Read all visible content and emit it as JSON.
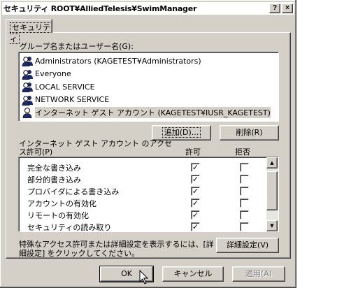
{
  "window": {
    "title": "セキュリティ ROOT¥AlliedTelesis¥SwimManager",
    "help_label": "?",
    "close_label": "×"
  },
  "tab": {
    "label": "セキュリティ"
  },
  "users": {
    "label": "グループ名またはユーザー名(G):",
    "items": [
      {
        "name": "Administrators (KAGETEST¥Administrators)",
        "icon": "group-icon"
      },
      {
        "name": "Everyone",
        "icon": "group-icon"
      },
      {
        "name": "LOCAL SERVICE",
        "icon": "group-icon"
      },
      {
        "name": "NETWORK SERVICE",
        "icon": "group-icon"
      },
      {
        "name": "インターネット ゲスト アカウント (KAGETEST¥IUSR_KAGETEST)",
        "icon": "user-icon",
        "selected": true
      }
    ],
    "add_label": "追加(D)...",
    "remove_label": "削除(R)"
  },
  "permissions": {
    "label_line1": "インターネット ゲスト アカウント のアクセ",
    "label_line2": "ス許可(P)",
    "allow_header": "許可",
    "deny_header": "拒否",
    "rows": [
      {
        "name": "完全な書き込み",
        "allow": true,
        "deny": false
      },
      {
        "name": "部分的書き込み",
        "allow": true,
        "deny": false
      },
      {
        "name": "プロバイダによる書き込み",
        "allow": true,
        "deny": false
      },
      {
        "name": "アカウントの有効化",
        "allow": true,
        "deny": false
      },
      {
        "name": "リモートの有効化",
        "allow": true,
        "deny": false
      },
      {
        "name": "セキュリティの読み取り",
        "allow": true,
        "deny": false
      }
    ]
  },
  "advanced": {
    "note_line1": "特殊なアクセス許可または詳細設定を表示するには、[詳",
    "note_line2": "細設定] をクリックしてください。",
    "button_label": "詳細設定(V)"
  },
  "footer": {
    "ok_label": "OK",
    "cancel_label": "キャンセル",
    "apply_label": "適用(A)"
  },
  "colors": {
    "dialog_bg": "#d4d0c8",
    "selection_bg": "#d4d0c8"
  }
}
